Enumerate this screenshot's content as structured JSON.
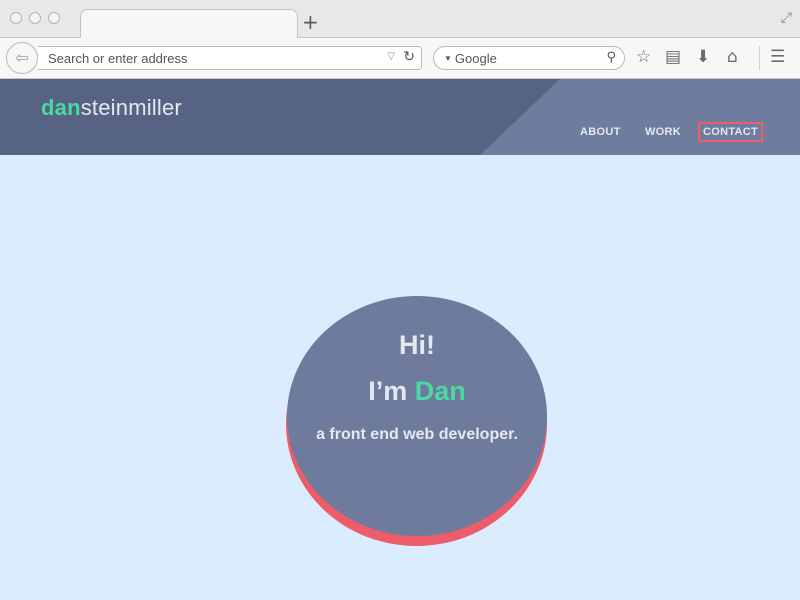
{
  "browser": {
    "url_placeholder": "Search or enter address",
    "search_engine": "Google",
    "new_tab_symbol": "+"
  },
  "site": {
    "logo_accent": "dan",
    "logo_rest": "steinmiller",
    "nav": [
      {
        "label": "ABOUT",
        "active": false
      },
      {
        "label": "WORK",
        "active": false
      },
      {
        "label": "CONTACT",
        "active": true
      }
    ]
  },
  "hero": {
    "greeting": "Hi!",
    "intro_prefix": "I’m ",
    "intro_name": "Dan",
    "tagline": "a front end web developer."
  },
  "colors": {
    "page_bg": "#daecfd",
    "header_bg": "#576382",
    "accent_green": "#49d9a1",
    "accent_red": "#ed5d69",
    "disc": "#6e7b9c"
  },
  "icons": [
    "back-arrow-icon",
    "dropdown-icon",
    "reload-icon",
    "search-icon",
    "bookmark-star-icon",
    "clipboard-icon",
    "download-icon",
    "home-icon",
    "menu-icon",
    "fullscreen-icon"
  ]
}
